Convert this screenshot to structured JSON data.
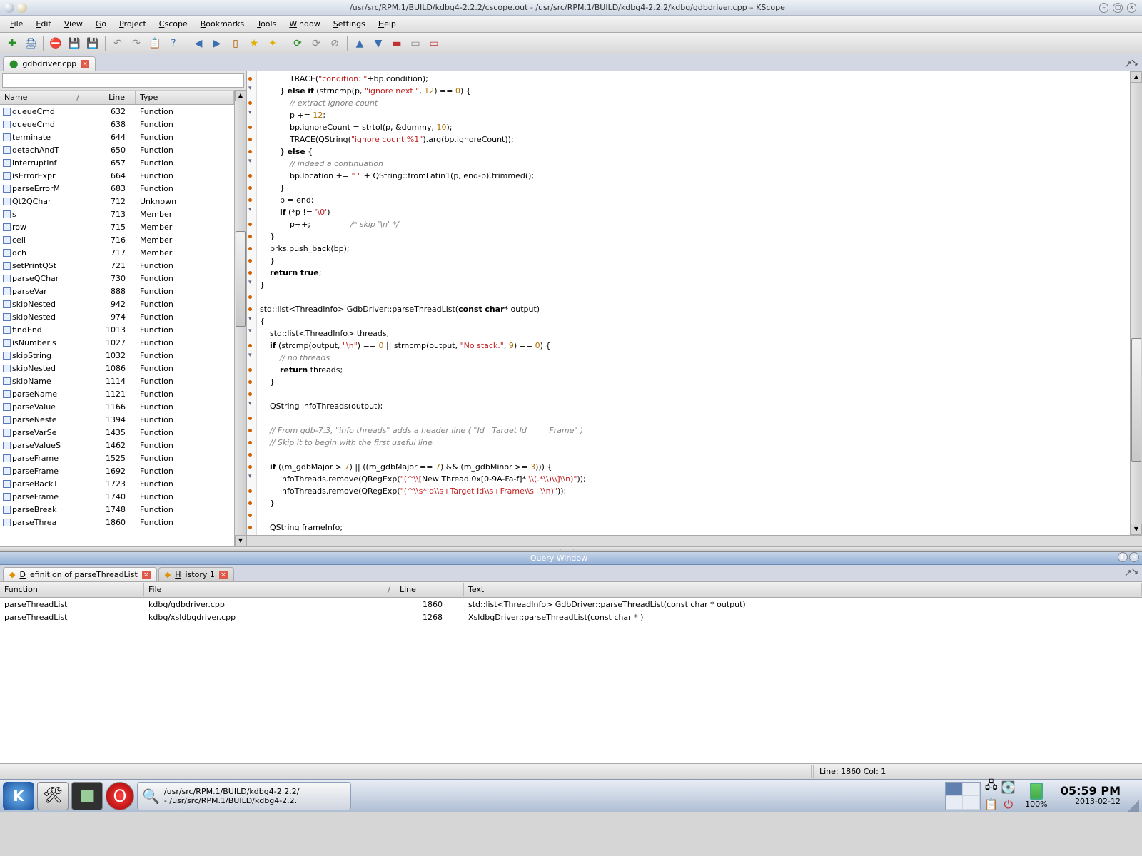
{
  "title": "/usr/src/RPM.1/BUILD/kdbg4-2.2.2/cscope.out - /usr/src/RPM.1/BUILD/kdbg4-2.2.2/kdbg/gdbdriver.cpp – KScope",
  "menu": [
    "File",
    "Edit",
    "View",
    "Go",
    "Project",
    "Cscope",
    "Bookmarks",
    "Tools",
    "Window",
    "Settings",
    "Help"
  ],
  "filetab": "gdbdriver.cpp",
  "sym_headers": {
    "name": "Name",
    "line": "Line",
    "type": "Type"
  },
  "symbols": [
    {
      "n": "queueCmd",
      "l": "632",
      "t": "Function"
    },
    {
      "n": "queueCmd",
      "l": "638",
      "t": "Function"
    },
    {
      "n": "terminate",
      "l": "644",
      "t": "Function"
    },
    {
      "n": "detachAndT",
      "l": "650",
      "t": "Function"
    },
    {
      "n": "interruptInf",
      "l": "657",
      "t": "Function"
    },
    {
      "n": "isErrorExpr",
      "l": "664",
      "t": "Function"
    },
    {
      "n": "parseErrorM",
      "l": "683",
      "t": "Function"
    },
    {
      "n": "Qt2QChar",
      "l": "712",
      "t": "Unknown"
    },
    {
      "n": "s",
      "l": "713",
      "t": "Member"
    },
    {
      "n": "row",
      "l": "715",
      "t": "Member"
    },
    {
      "n": "cell",
      "l": "716",
      "t": "Member"
    },
    {
      "n": "qch",
      "l": "717",
      "t": "Member"
    },
    {
      "n": "setPrintQSt",
      "l": "721",
      "t": "Function"
    },
    {
      "n": "parseQChar",
      "l": "730",
      "t": "Function"
    },
    {
      "n": "parseVar",
      "l": "888",
      "t": "Function"
    },
    {
      "n": "skipNested",
      "l": "942",
      "t": "Function"
    },
    {
      "n": "skipNested",
      "l": "974",
      "t": "Function"
    },
    {
      "n": "findEnd",
      "l": "1013",
      "t": "Function"
    },
    {
      "n": "isNumberis",
      "l": "1027",
      "t": "Function"
    },
    {
      "n": "skipString",
      "l": "1032",
      "t": "Function"
    },
    {
      "n": "skipNested",
      "l": "1086",
      "t": "Function"
    },
    {
      "n": "skipName",
      "l": "1114",
      "t": "Function"
    },
    {
      "n": "parseName",
      "l": "1121",
      "t": "Function"
    },
    {
      "n": "parseValue",
      "l": "1166",
      "t": "Function"
    },
    {
      "n": "parseNeste",
      "l": "1394",
      "t": "Function"
    },
    {
      "n": "parseVarSe",
      "l": "1435",
      "t": "Function"
    },
    {
      "n": "parseValueS",
      "l": "1462",
      "t": "Function"
    },
    {
      "n": "parseFrame",
      "l": "1525",
      "t": "Function"
    },
    {
      "n": "parseFrame",
      "l": "1692",
      "t": "Function"
    },
    {
      "n": "parseBackT",
      "l": "1723",
      "t": "Function"
    },
    {
      "n": "parseFrame",
      "l": "1740",
      "t": "Function"
    },
    {
      "n": "parseBreak",
      "l": "1748",
      "t": "Function"
    },
    {
      "n": "parseThrea",
      "l": "1860",
      "t": "Function"
    }
  ],
  "fold_markers": [
    1,
    3,
    7,
    11,
    17,
    20,
    21,
    23,
    27,
    33
  ],
  "highlight_line": 19,
  "code_lines": [
    {
      "i": 16,
      "h": "            TRACE(<s>\"condition: \"</s>+bp.condition);"
    },
    {
      "i": 10,
      "h": "        } <k>else</k> <k>if</k> (strncmp(p, <s>\"ignore next \"</s>, <n>12</n>) == <n>0</n>) {"
    },
    {
      "i": 12,
      "h": "            <c>// extract ignore count</c>"
    },
    {
      "i": 12,
      "h": "            p += <n>12</n>;"
    },
    {
      "i": 12,
      "h": "            bp.ignoreCount = strtol(p, &dummy, <n>10</n>);"
    },
    {
      "i": 12,
      "h": "            TRACE(QString(<s>\"ignore count %1\"</s>).arg(bp.ignoreCount));"
    },
    {
      "i": 10,
      "h": "        } <k>else</k> {"
    },
    {
      "i": 12,
      "h": "            <c>// indeed a continuation</c>"
    },
    {
      "i": 12,
      "h": "            bp.location += <s>\" \"</s> + QString::fromLatin1(p, end-p).trimmed();"
    },
    {
      "i": 10,
      "h": "        }"
    },
    {
      "i": 10,
      "h": "        p = end;"
    },
    {
      "i": 10,
      "h": "        <k>if</k> (*p != <s>'\\0'</s>)"
    },
    {
      "i": 12,
      "h": "            p++;                <c>/* skip '\\n' */</c>"
    },
    {
      "i": 8,
      "h": "    }"
    },
    {
      "i": 8,
      "h": "    brks.push_back(bp);"
    },
    {
      "i": 4,
      "h": "    }"
    },
    {
      "i": 4,
      "h": "    <k>return</k> <k>true</k>;"
    },
    {
      "i": 0,
      "h": "}"
    },
    {
      "i": 0,
      "h": ""
    },
    {
      "i": 0,
      "h": "std::list&lt;ThreadInfo&gt; GdbDriver::parseThreadList(<k>const</k> <k>char</k>* output)"
    },
    {
      "i": 0,
      "h": "{"
    },
    {
      "i": 4,
      "h": "    std::list&lt;ThreadInfo&gt; threads;"
    },
    {
      "i": 4,
      "h": "    <k>if</k> (strcmp(output, <s>\"\\n\"</s>) == <n>0</n> || strncmp(output, <s>\"No stack.\"</s>, <n>9</n>) == <n>0</n>) {"
    },
    {
      "i": 8,
      "h": "        <c>// no threads</c>"
    },
    {
      "i": 8,
      "h": "        <k>return</k> threads;"
    },
    {
      "i": 4,
      "h": "    }"
    },
    {
      "i": 0,
      "h": ""
    },
    {
      "i": 4,
      "h": "    QString infoThreads(output);"
    },
    {
      "i": 0,
      "h": ""
    },
    {
      "i": 4,
      "h": "    <c>// From gdb-7.3, \"info threads\" adds a header line ( \"Id   Target Id         Frame\" )</c>"
    },
    {
      "i": 4,
      "h": "    <c>// Skip it to begin with the first useful line</c>"
    },
    {
      "i": 0,
      "h": ""
    },
    {
      "i": 4,
      "h": "    <k>if</k> ((m_gdbMajor &gt; <n>7</n>) || ((m_gdbMajor == <n>7</n>) &amp;&amp; (m_gdbMinor &gt;= <n>3</n>))) {"
    },
    {
      "i": 8,
      "h": "        infoThreads.remove(QRegExp(<s>\"(^\\\\[</s>New Thread 0x[0-9A-Fa-f]*<s> \\\\(.*\\\\)\\\\]\\\\n)\"</s>));"
    },
    {
      "i": 8,
      "h": "        infoThreads.remove(QRegExp(<s>\"(^\\\\s*Id\\\\s+Target Id\\\\s+Frame\\\\s+\\\\n)\"</s>));"
    },
    {
      "i": 4,
      "h": "    }"
    },
    {
      "i": 0,
      "h": ""
    },
    {
      "i": 4,
      "h": "    QString frameInfo;"
    }
  ],
  "query_title": "Query Window",
  "qtabs": [
    {
      "label": "Definition of parseThreadList",
      "close": true,
      "active": true
    },
    {
      "label": "History 1",
      "close": true,
      "active": false
    }
  ],
  "qheaders": {
    "fn": "Function",
    "file": "File",
    "line": "Line",
    "text": "Text"
  },
  "qrows": [
    {
      "fn": "parseThreadList",
      "fi": "kdbg/gdbdriver.cpp",
      "li": "1860",
      "tx": "std::list<ThreadInfo> GdbDriver::parseThreadList(const char * output)"
    },
    {
      "fn": "parseThreadList",
      "fi": "kdbg/xsldbgdriver.cpp",
      "li": "1268",
      "tx": "XsldbgDriver::parseThreadList(const char * )"
    }
  ],
  "status": "Line: 1860 Col: 1",
  "task_lines": [
    "/usr/src/RPM.1/BUILD/kdbg4-2.2.2/",
    "- /usr/src/RPM.1/BUILD/kdbg4-2.2."
  ],
  "battery": "100%",
  "clock_time": "05:59 PM",
  "clock_date": "2013-02-12"
}
